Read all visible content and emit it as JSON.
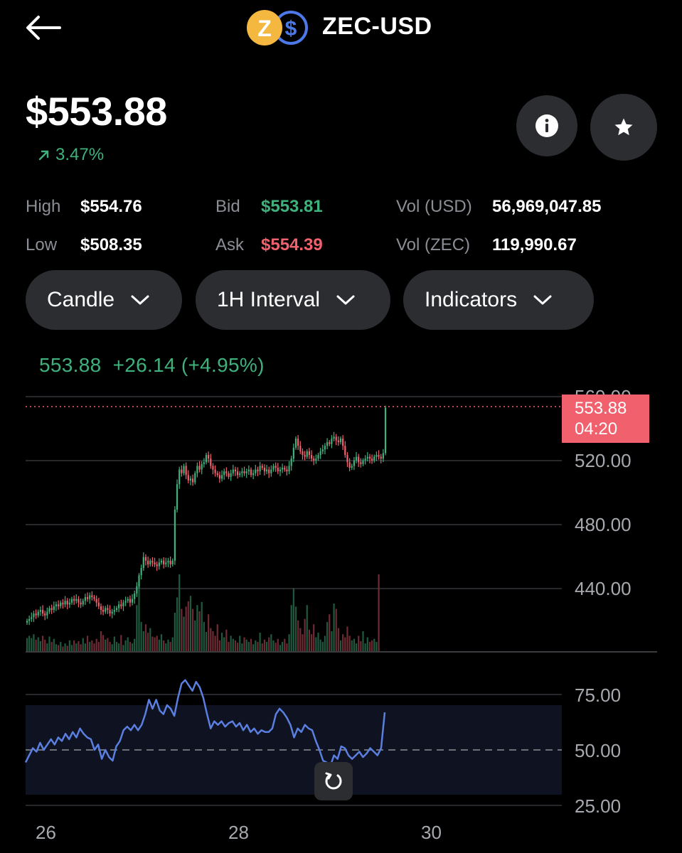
{
  "header": {
    "back_icon": "arrow-left-icon",
    "pair": "ZEC-USD",
    "coin_letter": "Z",
    "quote_letter": "$"
  },
  "price": {
    "value": "$553.88",
    "change": "3.47%",
    "change_icon": "arrow-up-right-icon"
  },
  "actions": {
    "info_icon": "info-icon",
    "favorite_icon": "star-icon"
  },
  "stats": {
    "high_label": "High",
    "high": "$554.76",
    "low_label": "Low",
    "low": "$508.35",
    "bid_label": "Bid",
    "bid": "$553.81",
    "ask_label": "Ask",
    "ask": "$554.39",
    "vol_usd_label": "Vol (USD)",
    "vol_usd": "56,969,047.85",
    "vol_zec_label": "Vol (ZEC)",
    "vol_zec": "119,990.67"
  },
  "controls": {
    "chart_type": "Candle",
    "interval": "1H Interval",
    "indicators": "Indicators"
  },
  "chart": {
    "summary": "553.88  +26.14 (+4.95%)",
    "price_tag": {
      "price": "553.88",
      "countdown": "04:20"
    },
    "y_labels": [
      "560.00",
      "520.00",
      "480.00",
      "440.00"
    ],
    "rsi_labels": [
      "75.00",
      "50.00",
      "25.00"
    ],
    "x_labels": [
      "26",
      "28",
      "30"
    ],
    "reset_icon": "refresh-icon",
    "colors": {
      "up": "#3fb17d",
      "down": "#f0616d",
      "rsi": "#5b7fe0"
    }
  },
  "chart_data": {
    "type": "candlestick",
    "y_range": [
      420,
      560
    ],
    "x_ticks": [
      "26",
      "28",
      "30"
    ],
    "close": [
      437,
      438,
      439,
      441,
      440,
      442,
      443,
      441,
      440,
      442,
      444,
      443,
      445,
      446,
      445,
      447,
      446,
      448,
      446,
      447,
      449,
      448,
      449,
      447,
      446,
      448,
      450,
      449,
      451,
      450,
      449,
      447,
      445,
      443,
      442,
      444,
      443,
      441,
      442,
      443,
      444,
      446,
      445,
      447,
      448,
      449,
      447,
      449,
      452,
      456,
      462,
      466,
      472,
      470,
      468,
      470,
      469,
      468,
      467,
      469,
      470,
      468,
      469,
      470,
      468,
      470,
      498,
      512,
      520,
      518,
      522,
      517,
      514,
      515,
      513,
      518,
      522,
      520,
      523,
      524,
      528,
      526,
      522,
      520,
      518,
      517,
      515,
      517,
      519,
      518,
      516,
      518,
      520,
      519,
      517,
      518,
      519,
      518,
      519,
      520,
      517,
      518,
      520,
      519,
      522,
      521,
      519,
      520,
      518,
      520,
      522,
      521,
      519,
      520,
      521,
      520,
      519,
      522,
      526,
      532,
      537,
      533,
      530,
      528,
      527,
      530,
      528,
      526,
      525,
      526,
      528,
      530,
      531,
      533,
      535,
      534,
      537,
      538,
      536,
      535,
      537,
      533,
      528,
      524,
      521,
      522,
      525,
      527,
      524,
      523,
      525,
      526,
      527,
      526,
      525,
      527,
      528,
      527,
      526,
      529,
      553.88
    ],
    "volume": [
      0.17,
      0.2,
      0.17,
      0.22,
      0.15,
      0.18,
      0.13,
      0.2,
      0.15,
      0.1,
      0.19,
      0.12,
      0.16,
      0.09,
      0.08,
      0.12,
      0.06,
      0.1,
      0.07,
      0.14,
      0.08,
      0.14,
      0.1,
      0.13,
      0.09,
      0.17,
      0.1,
      0.2,
      0.12,
      0.14,
      0.1,
      0.16,
      0.12,
      0.26,
      0.21,
      0.15,
      0.17,
      0.12,
      0.09,
      0.19,
      0.12,
      0.1,
      0.21,
      0.08,
      0.14,
      0.18,
      0.12,
      0.1,
      0.16,
      0.6,
      0.88,
      0.38,
      0.26,
      0.35,
      0.24,
      0.3,
      0.19,
      0.18,
      0.2,
      0.15,
      0.22,
      0.14,
      0.1,
      0.15,
      0.12,
      0.18,
      0.5,
      0.7,
      1.0,
      0.55,
      0.45,
      0.58,
      0.65,
      0.72,
      0.55,
      0.4,
      0.6,
      0.52,
      0.64,
      0.38,
      0.25,
      0.48,
      0.3,
      0.26,
      0.2,
      0.35,
      0.14,
      0.24,
      0.18,
      0.28,
      0.12,
      0.2,
      0.16,
      0.14,
      0.11,
      0.2,
      0.1,
      0.18,
      0.15,
      0.12,
      0.16,
      0.09,
      0.14,
      0.12,
      0.24,
      0.1,
      0.15,
      0.12,
      0.18,
      0.22,
      0.14,
      0.11,
      0.16,
      0.08,
      0.12,
      0.16,
      0.1,
      0.22,
      0.6,
      0.82,
      0.58,
      0.4,
      0.3,
      0.22,
      0.42,
      0.6,
      0.28,
      0.22,
      0.35,
      0.18,
      0.24,
      0.15,
      0.12,
      0.2,
      0.38,
      0.48,
      0.26,
      0.62,
      0.55,
      0.3,
      0.14,
      0.22,
      0.18,
      0.32,
      0.2,
      0.14,
      0.16,
      0.1,
      0.2,
      0.13,
      0.26,
      0.1,
      0.18,
      0.12,
      0.14,
      0.16,
      0.12,
      1.0
    ]
  },
  "rsi_data": {
    "type": "line",
    "y_range": [
      25,
      75
    ],
    "reference": 50,
    "values": [
      43,
      47,
      51,
      49,
      54,
      50,
      53,
      56,
      53,
      57,
      55,
      59,
      56,
      60,
      57,
      62,
      59,
      57,
      56,
      50,
      53,
      45,
      50,
      46,
      44,
      52,
      55,
      61,
      63,
      61,
      64,
      61,
      64,
      70,
      78,
      73,
      78,
      72,
      70,
      75,
      73,
      69,
      79,
      87,
      89,
      86,
      83,
      88,
      85,
      79,
      70,
      62,
      66,
      64,
      66,
      63,
      65,
      66,
      63,
      65,
      61,
      64,
      60,
      62,
      59,
      61,
      60,
      60,
      62,
      70,
      73,
      71,
      68,
      64,
      57,
      62,
      60,
      64,
      62,
      61,
      55,
      50,
      44,
      43,
      41,
      47,
      45,
      52,
      51,
      47,
      45,
      47,
      49,
      46,
      48,
      51,
      49,
      47,
      51,
      71
    ]
  }
}
